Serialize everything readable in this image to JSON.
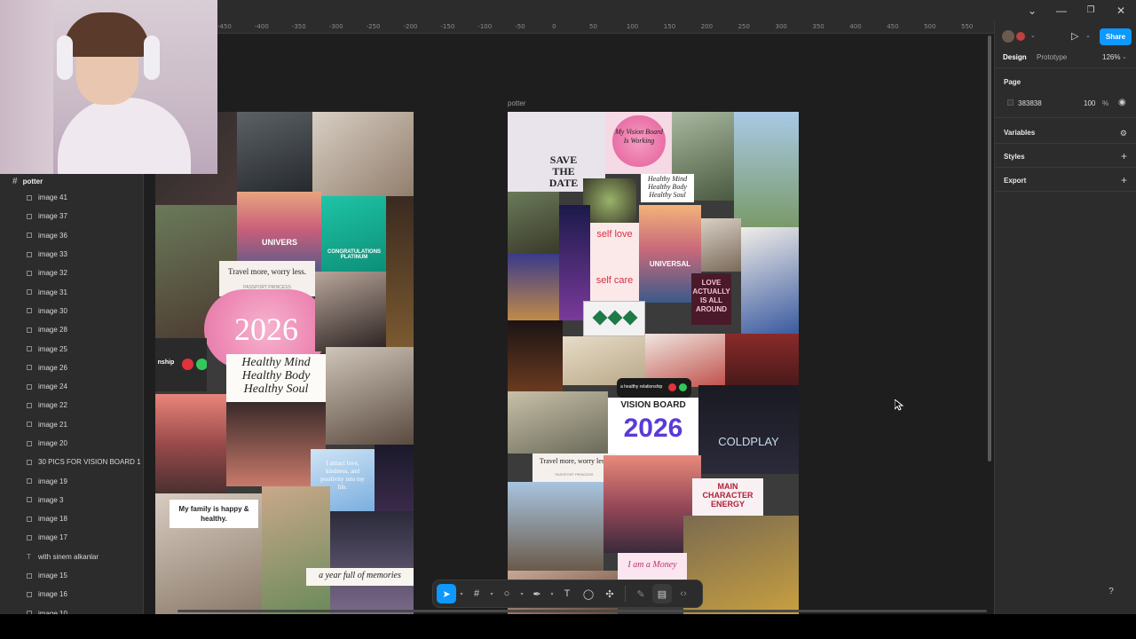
{
  "window": {
    "controls": [
      "⌄",
      "—",
      "❐",
      "✕"
    ]
  },
  "ruler": {
    "ticks": [
      "-450",
      "-400",
      "-350",
      "-300",
      "-250",
      "-200",
      "-150",
      "-100",
      "-50",
      "0",
      "50",
      "100",
      "150",
      "200",
      "250",
      "300",
      "350",
      "400",
      "450",
      "500",
      "550",
      "600",
      "650",
      "700",
      "750"
    ]
  },
  "canvas": {
    "frame_label": "potter"
  },
  "left_collage": {
    "texts": {
      "travel": "Travel more, worry less.",
      "passport": "PASSPORT PRINCESS",
      "year": "2026",
      "healthy": "Healthy Mind Healthy Body Healthy Soul",
      "ship": "nship",
      "family": "My family is happy & healthy.",
      "attract": "I attract love, kindness, and positivity into my life.",
      "memories": "a year full of memories",
      "platinum": "CONGRATULATIONS PLATINUM",
      "univers": "UNIVERS"
    }
  },
  "right_collage": {
    "texts": {
      "save_the_date": "SAVE THE DATE",
      "heart": "My Vision Board Is Working",
      "healthy": "Healthy Mind Healthy Body Healthy Soul",
      "self_love": "self love",
      "self_care": "self care",
      "universal": "UNIVERSAL",
      "love_actually": "LOVE ACTUALLY IS ALL AROUND",
      "relationship": "a healthy relationship",
      "vision_board": "VISION BOARD",
      "vision_year": "2026",
      "coldplay": "COLDPLAY",
      "travel": "Travel more, worry less.",
      "passport": "PASSPORT PRINCESS",
      "main_character": "MAIN CHARACTER ENERGY",
      "money": "I am a Money",
      "small_caption": "with sinem alkanlar"
    }
  },
  "layers": {
    "page_name": "potter",
    "items": [
      {
        "label": "image 41",
        "type": "image"
      },
      {
        "label": "image 37",
        "type": "image"
      },
      {
        "label": "image 36",
        "type": "image"
      },
      {
        "label": "image 33",
        "type": "image"
      },
      {
        "label": "image 32",
        "type": "image"
      },
      {
        "label": "image 31",
        "type": "image"
      },
      {
        "label": "image 30",
        "type": "image"
      },
      {
        "label": "image 28",
        "type": "image"
      },
      {
        "label": "image 25",
        "type": "image"
      },
      {
        "label": "image 26",
        "type": "image"
      },
      {
        "label": "image 24",
        "type": "image"
      },
      {
        "label": "image 22",
        "type": "image"
      },
      {
        "label": "image 21",
        "type": "image"
      },
      {
        "label": "image 20",
        "type": "image"
      },
      {
        "label": "30 PICS FOR VISION BOARD 1",
        "type": "image"
      },
      {
        "label": "image 19",
        "type": "image"
      },
      {
        "label": "image 3",
        "type": "image"
      },
      {
        "label": "image 18",
        "type": "image"
      },
      {
        "label": "image 17",
        "type": "image"
      },
      {
        "label": "with sinem alkanlar",
        "type": "text"
      },
      {
        "label": "image 15",
        "type": "image"
      },
      {
        "label": "image 16",
        "type": "image"
      },
      {
        "label": "image 10",
        "type": "image"
      }
    ]
  },
  "right_panel": {
    "tabs": {
      "design": "Design",
      "prototype": "Prototype"
    },
    "zoom": "126%",
    "share": "Share",
    "page_section": "Page",
    "page_color": "383838",
    "page_opacity": "100",
    "percent": "%",
    "variables": "Variables",
    "styles": "Styles",
    "export": "Export"
  },
  "toolbar": {
    "help": "?"
  },
  "colors": {
    "accent": "#0d99ff",
    "panel": "#2c2c2c",
    "canvas": "#1e1e1e"
  }
}
